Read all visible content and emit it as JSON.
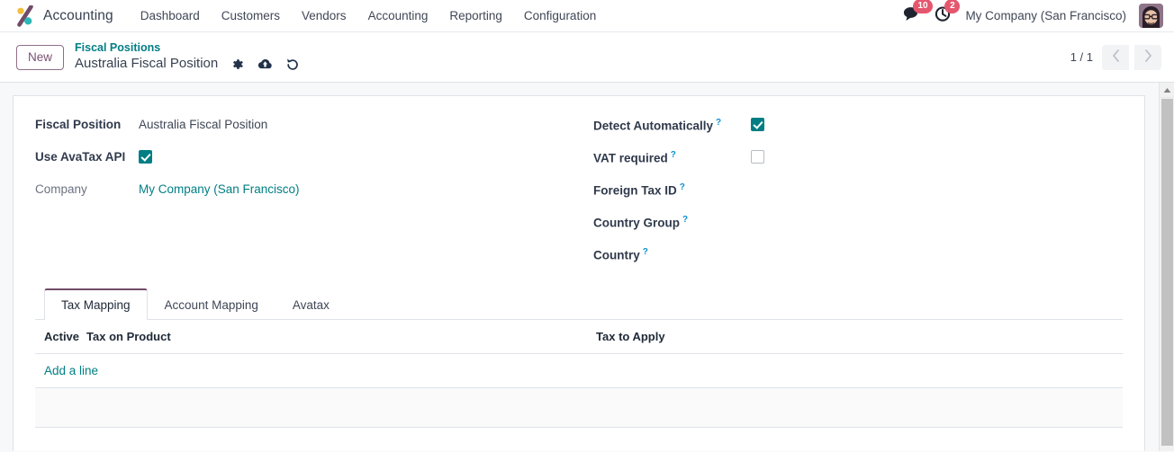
{
  "navbar": {
    "brand": "Accounting",
    "logo_icon": "odoo-accounting-logo-icon",
    "menu": [
      {
        "label": "Dashboard"
      },
      {
        "label": "Customers"
      },
      {
        "label": "Vendors"
      },
      {
        "label": "Accounting"
      },
      {
        "label": "Reporting"
      },
      {
        "label": "Configuration"
      }
    ],
    "messages": {
      "icon": "messages-chat-icon",
      "count": "10"
    },
    "activities": {
      "icon": "activity-clock-icon",
      "count": "2"
    },
    "company": "My Company (San Francisco)",
    "avatar_icon": "user-avatar"
  },
  "control_bar": {
    "new_label": "New",
    "breadcrumb_parent": "Fiscal Positions",
    "record_title": "Australia Fiscal Position",
    "actions": [
      {
        "icon": "gear-icon",
        "name": "settings-cog"
      },
      {
        "icon": "cloud-upload-icon",
        "name": "save-record"
      },
      {
        "icon": "undo-icon",
        "name": "discard-changes"
      }
    ],
    "pager": {
      "count": "1 / 1",
      "prev_icon": "chevron-left-icon",
      "next_icon": "chevron-right-icon"
    }
  },
  "form": {
    "left": [
      {
        "label": "Fiscal Position",
        "type": "text",
        "value": "Australia Fiscal Position",
        "bold": true
      },
      {
        "label": "Use AvaTax API",
        "type": "checkbox",
        "checked": true,
        "bold": true
      },
      {
        "label": "Company",
        "type": "link",
        "value": "My Company (San Francisco)",
        "bold": false
      }
    ],
    "right": [
      {
        "label": "Detect Automatically",
        "type": "checkbox",
        "checked": true,
        "help": "?"
      },
      {
        "label": "VAT required",
        "type": "checkbox",
        "checked": false,
        "help": "?"
      },
      {
        "label": "Foreign Tax ID",
        "type": "text",
        "value": "",
        "help": "?"
      },
      {
        "label": "Country Group",
        "type": "text",
        "value": "",
        "help": "?"
      },
      {
        "label": "Country",
        "type": "text",
        "value": "",
        "help": "?"
      }
    ]
  },
  "notebook": {
    "tabs": [
      {
        "label": "Tax Mapping",
        "active": true
      },
      {
        "label": "Account Mapping",
        "active": false
      },
      {
        "label": "Avatax",
        "active": false
      }
    ],
    "table": {
      "headers": [
        "Active",
        "Tax on Product",
        "Tax to Apply"
      ],
      "rows": [],
      "add_line_label": "Add a line"
    }
  },
  "colors": {
    "accent_teal": "#017e84",
    "brand_purple": "#714b67",
    "badge_red": "#e4576e",
    "page_bg": "#f7f8fa"
  }
}
